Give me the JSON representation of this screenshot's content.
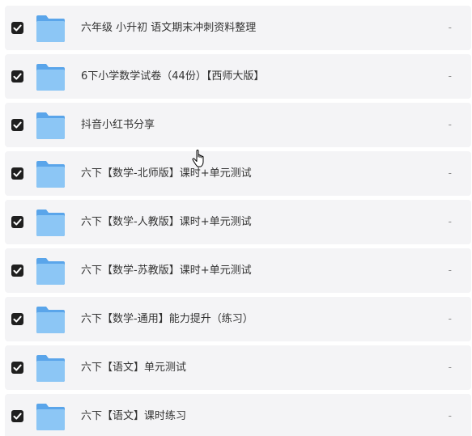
{
  "files": [
    {
      "name": "六年级 小升初 语文期末冲刺资料整理",
      "meta": "-",
      "checked": true,
      "icon": "folder-icon"
    },
    {
      "name": "6下小学数学试卷（44份）【西师大版】",
      "meta": "-",
      "checked": true,
      "icon": "folder-icon"
    },
    {
      "name": "抖音小红书分享",
      "meta": "-",
      "checked": true,
      "icon": "folder-icon"
    },
    {
      "name": "六下【数学-北师版】课时+单元测试",
      "meta": "-",
      "checked": true,
      "icon": "folder-icon"
    },
    {
      "name": "六下【数学-人教版】课时+单元测试",
      "meta": "-",
      "checked": true,
      "icon": "folder-icon"
    },
    {
      "name": "六下【数学-苏教版】课时+单元测试",
      "meta": "-",
      "checked": true,
      "icon": "folder-icon"
    },
    {
      "name": "六下【数学-通用】能力提升（练习）",
      "meta": "-",
      "checked": true,
      "icon": "folder-icon"
    },
    {
      "name": "六下【语文】单元测试",
      "meta": "-",
      "checked": true,
      "icon": "folder-icon"
    },
    {
      "name": "六下【语文】课时练习",
      "meta": "-",
      "checked": true,
      "icon": "folder-icon"
    }
  ],
  "colors": {
    "row_background": "#f4f4f6",
    "checkbox": "#1f1f1f",
    "folder_back": "#5aa5ea",
    "folder_front": "#8cc6f5"
  },
  "cursor_icon": "hand-pointer-icon"
}
